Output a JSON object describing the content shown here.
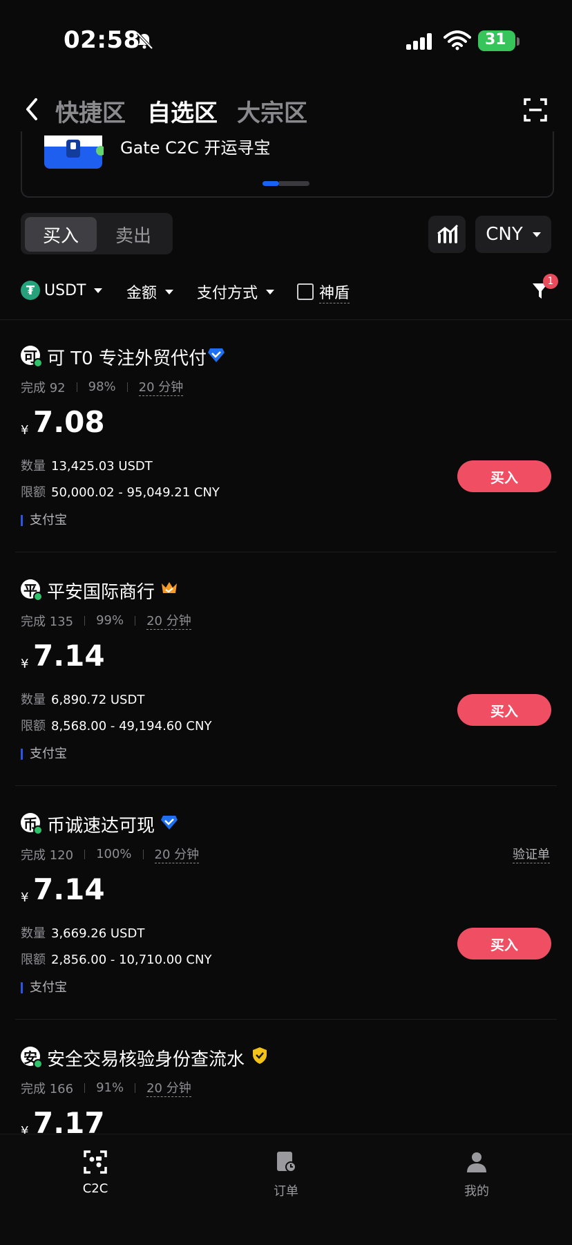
{
  "status_bar": {
    "time": "02:58",
    "battery": "31"
  },
  "header": {
    "tabs": [
      "快捷区",
      "自选区",
      "大宗区"
    ],
    "active_tab": "自选区"
  },
  "banner": {
    "text": "Gate C2C 开运寻宝"
  },
  "trade_toggle": {
    "buy": "买入",
    "sell": "卖出",
    "active": "买入"
  },
  "currency": "CNY",
  "filters": {
    "coin": "USDT",
    "amount": "金额",
    "payment": "支付方式",
    "shield": "神盾",
    "filter_badge": "1"
  },
  "labels": {
    "qty": "数量",
    "limit": "限额",
    "completed": "完成",
    "yen": "¥",
    "buy_button": "买入"
  },
  "listings": [
    {
      "avatar": "可",
      "name": "可 T0 专注外贸代付",
      "badge": "blue-diamond",
      "completed": "完成 92",
      "rate": "98%",
      "time": "20 分钟",
      "verify": "",
      "price": "7.08",
      "quantity": "13,425.03 USDT",
      "limit": "50,000.02 - 95,049.21 CNY",
      "payment": "支付宝"
    },
    {
      "avatar": "平",
      "name": "平安国际商行",
      "badge": "orange-crown",
      "completed": "完成 135",
      "rate": "99%",
      "time": "20 分钟",
      "verify": "",
      "price": "7.14",
      "quantity": "6,890.72 USDT",
      "limit": "8,568.00 - 49,194.60 CNY",
      "payment": "支付宝"
    },
    {
      "avatar": "币",
      "name": "币诚速达可现",
      "badge": "blue-diamond",
      "completed": "完成 120",
      "rate": "100%",
      "time": "20 分钟",
      "verify": "验证单",
      "price": "7.14",
      "quantity": "3,669.26 USDT",
      "limit": "2,856.00 - 10,710.00 CNY",
      "payment": "支付宝"
    },
    {
      "avatar": "安",
      "name": "安全交易核验身份查流水",
      "badge": "gold-shield",
      "completed": "完成 166",
      "rate": "91%",
      "time": "20 分钟",
      "verify": "",
      "price": "7.17"
    }
  ],
  "bottom_nav": [
    {
      "label": "C2C",
      "active": true
    },
    {
      "label": "订单",
      "active": false
    },
    {
      "label": "我的",
      "active": false
    }
  ],
  "colors": {
    "accent_blue": "#1763f5",
    "buy_red": "#f04e63",
    "online_green": "#2fc26b",
    "usdt_green": "#26a17b"
  }
}
